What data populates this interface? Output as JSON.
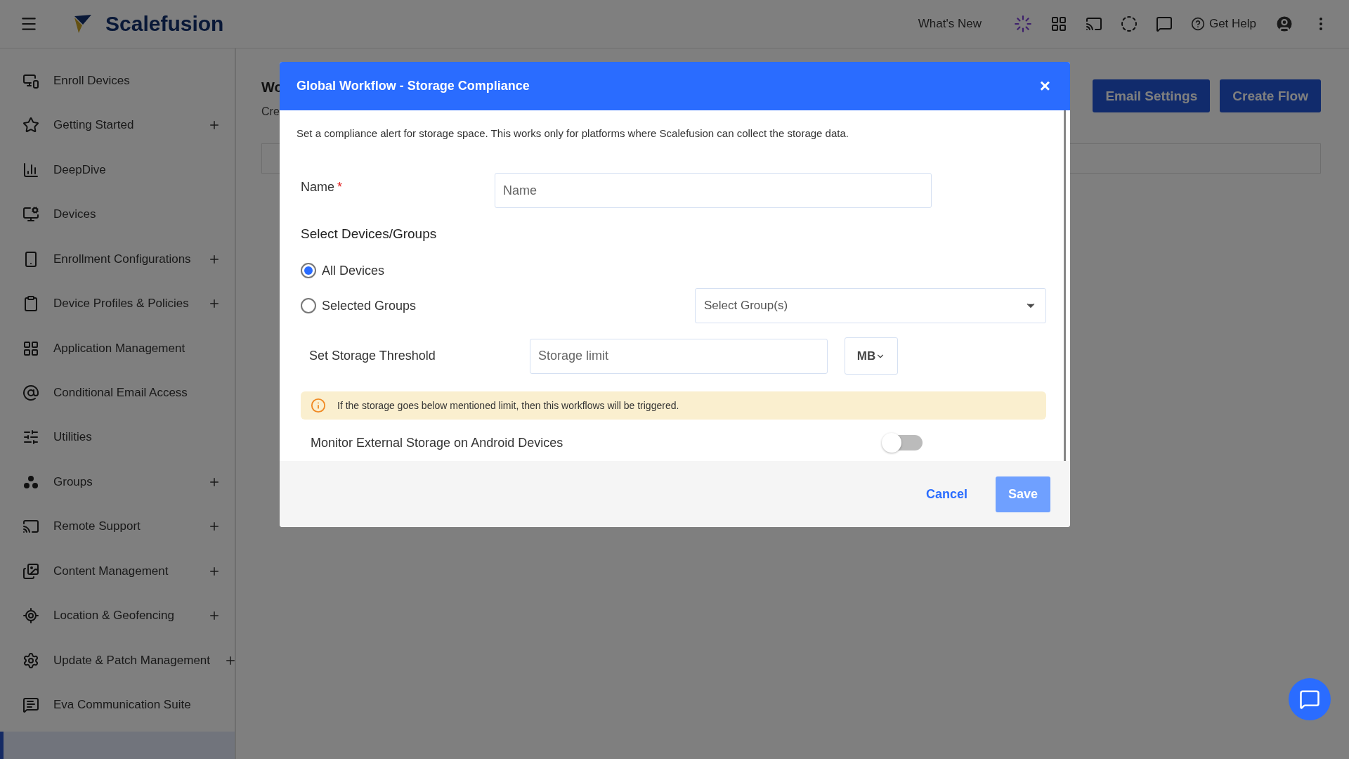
{
  "topbar": {
    "brand": "Scalefusion",
    "whats_new": "What's New",
    "help": "Get Help"
  },
  "sidebar": {
    "items": [
      {
        "label": "Enroll Devices",
        "expandable": false
      },
      {
        "label": "Getting Started",
        "expandable": true
      },
      {
        "label": "DeepDive",
        "expandable": false
      },
      {
        "label": "Devices",
        "expandable": false
      },
      {
        "label": "Enrollment Configurations",
        "expandable": true
      },
      {
        "label": "Device Profiles & Policies",
        "expandable": true
      },
      {
        "label": "Application Management",
        "expandable": false
      },
      {
        "label": "Conditional Email Access",
        "expandable": false
      },
      {
        "label": "Utilities",
        "expandable": false
      },
      {
        "label": "Groups",
        "expandable": true
      },
      {
        "label": "Remote Support",
        "expandable": true
      },
      {
        "label": "Content Management",
        "expandable": true
      },
      {
        "label": "Location & Geofencing",
        "expandable": true
      },
      {
        "label": "Update & Patch Management",
        "expandable": true
      },
      {
        "label": "Eva Communication Suite",
        "expandable": false
      }
    ]
  },
  "page": {
    "title": "Wo",
    "subtitle": "Cre",
    "buttons": [
      "Email Settings",
      "Create Flow"
    ]
  },
  "modal": {
    "title": "Global Workflow - Storage Compliance",
    "close": "×",
    "description": "Set a compliance alert for storage space. This works only for platforms where Scalefusion can collect the storage data.",
    "name_label": "Name",
    "required_mark": "*",
    "name_placeholder": "Name",
    "section": "Select Devices/Groups",
    "radios": [
      {
        "label": "All Devices",
        "selected": true
      },
      {
        "label": "Selected Groups",
        "selected": false
      }
    ],
    "group_placeholder": "Select Group(s)",
    "threshold_label": "Set Storage Threshold",
    "threshold_placeholder": "Storage limit",
    "unit": "MB",
    "info": "If the storage goes below mentioned limit, then this workflows will be triggered.",
    "external": {
      "label": "Monitor External Storage on Android Devices",
      "on": false
    },
    "cancel": "Cancel",
    "save": "Save"
  }
}
